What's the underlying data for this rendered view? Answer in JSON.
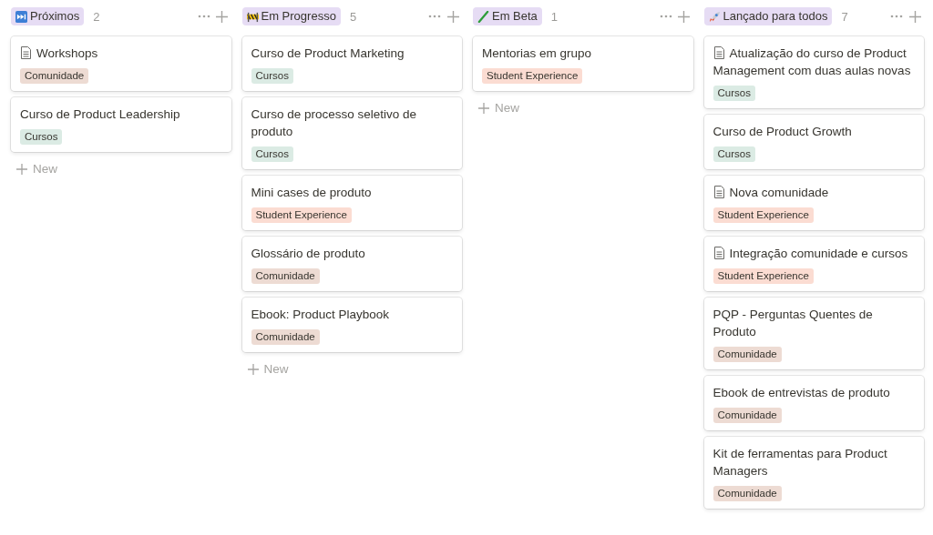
{
  "columns": [
    {
      "title": "Próximos",
      "count": "2",
      "cards": [
        {
          "title": "Workshops",
          "page_icon": true,
          "tag": {
            "label": "Comunidade",
            "color": "#eddbd3"
          }
        },
        {
          "title": "Curso de Product Leadership",
          "page_icon": false,
          "tag": {
            "label": "Cursos",
            "color": "#dbebe4"
          }
        }
      ],
      "new_label": "New"
    },
    {
      "title": "Em Progresso",
      "count": "5",
      "cards": [
        {
          "title": "Curso de Product Marketing",
          "page_icon": false,
          "tag": {
            "label": "Cursos",
            "color": "#dbebe4"
          }
        },
        {
          "title": "Curso de processo seletivo de produto",
          "page_icon": false,
          "tag": {
            "label": "Cursos",
            "color": "#dbebe4"
          }
        },
        {
          "title": "Mini cases de produto",
          "page_icon": false,
          "tag": {
            "label": "Student Experience",
            "color": "#fbdcd2"
          }
        },
        {
          "title": "Glossário de produto",
          "page_icon": false,
          "tag": {
            "label": "Comunidade",
            "color": "#eddbd3"
          }
        },
        {
          "title": "Ebook: Product Playbook",
          "page_icon": false,
          "tag": {
            "label": "Comunidade",
            "color": "#eddbd3"
          }
        }
      ],
      "new_label": "New"
    },
    {
      "title": "Em Beta",
      "count": "1",
      "cards": [
        {
          "title": "Mentorias em grupo",
          "page_icon": false,
          "tag": {
            "label": "Student Experience",
            "color": "#fbdcd2"
          }
        }
      ],
      "new_label": "New"
    },
    {
      "title": "Lançado para todos",
      "count": "7",
      "cards": [
        {
          "title": "Atualização do curso de Product Management com duas aulas novas",
          "page_icon": true,
          "tag": {
            "label": "Cursos",
            "color": "#dbebe4"
          }
        },
        {
          "title": "Curso de Product Growth",
          "page_icon": false,
          "tag": {
            "label": "Cursos",
            "color": "#dbebe4"
          }
        },
        {
          "title": "Nova comunidade",
          "page_icon": true,
          "tag": {
            "label": "Student Experience",
            "color": "#fbdcd2"
          }
        },
        {
          "title": "Integração comunidade e cursos",
          "page_icon": true,
          "tag": {
            "label": "Student Experience",
            "color": "#fbdcd2"
          }
        },
        {
          "title": "PQP - Perguntas Quentes de Produto",
          "page_icon": false,
          "tag": {
            "label": "Comunidade",
            "color": "#eddbd3"
          }
        },
        {
          "title": "Ebook de entrevistas de produto",
          "page_icon": false,
          "tag": {
            "label": "Comunidade",
            "color": "#eddbd3"
          }
        },
        {
          "title": "Kit de ferramentas para Product Managers",
          "page_icon": false,
          "tag": {
            "label": "Comunidade",
            "color": "#eddbd3"
          }
        }
      ]
    }
  ]
}
